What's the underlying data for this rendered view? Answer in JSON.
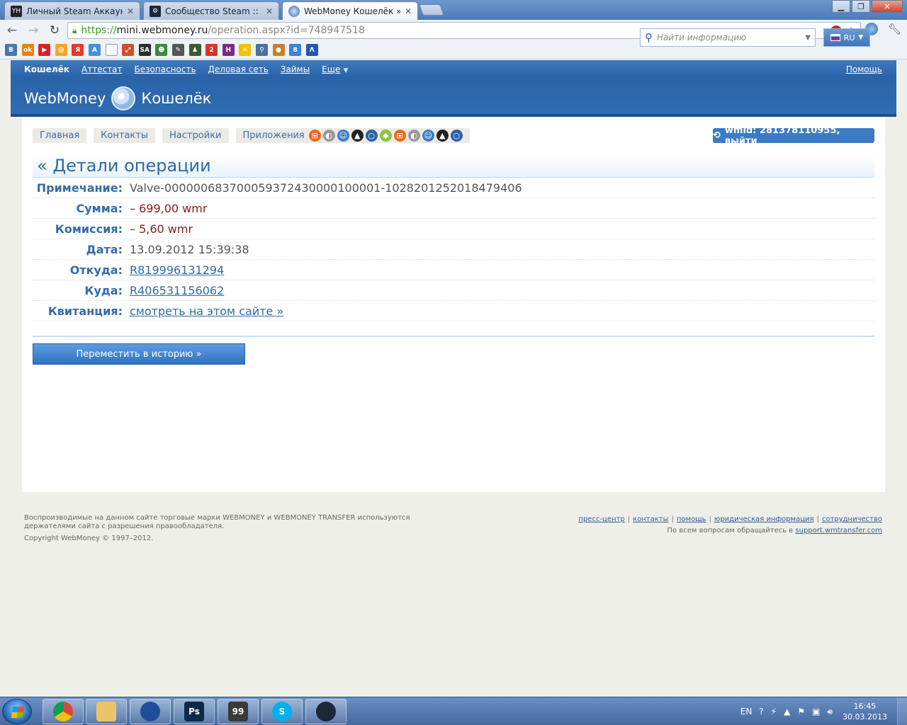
{
  "browser": {
    "tabs": [
      {
        "title": "Личный Steam Аккаунт",
        "favicon": "youhack-icon",
        "active": false
      },
      {
        "title": "Сообщество Steam :: Мо",
        "favicon": "steam-icon",
        "active": false
      },
      {
        "title": "WebMoney Кошелёк » Де",
        "favicon": "webmoney-globe-icon",
        "active": true
      }
    ],
    "url": {
      "scheme": "https://",
      "host": "mini.webmoney.ru",
      "path": "/operation.aspx?id=748947518"
    },
    "abp_label": "ABP",
    "bookmarks": [
      {
        "icon": "vk-icon",
        "label": "B",
        "color": "#4a76a8"
      },
      {
        "icon": "odnoklassniki-icon",
        "label": "ok",
        "color": "#ee8208"
      },
      {
        "icon": "youtube-icon",
        "label": "▶",
        "color": "#d32424"
      },
      {
        "icon": "moy-mir-icon",
        "label": "@",
        "color": "#f5a623"
      },
      {
        "icon": "yandex-icon",
        "label": "Я",
        "color": "#e53a2b"
      },
      {
        "icon": "a-icon",
        "label": "A",
        "color": "#4a90d9"
      },
      {
        "icon": "page-icon",
        "label": "",
        "color": "#ffffff"
      },
      {
        "icon": "link-icon",
        "label": "⤢",
        "color": "#d04e2f"
      },
      {
        "icon": "sa-icon",
        "label": "SA",
        "color": "#2b2b2b"
      },
      {
        "icon": "mask-icon",
        "label": "☻",
        "color": "#3a8a3a"
      },
      {
        "icon": "pen-icon",
        "label": "✎",
        "color": "#555555"
      },
      {
        "icon": "people-icon",
        "label": "♟",
        "color": "#3b5b2b"
      },
      {
        "icon": "2-icon",
        "label": "2",
        "color": "#d9342b"
      },
      {
        "icon": "h-icon",
        "label": "H",
        "color": "#7a2a8a"
      },
      {
        "icon": "x-icon",
        "label": "✕",
        "color": "#f2c200"
      },
      {
        "icon": "search-tool-icon",
        "label": "⚲",
        "color": "#4a6fa5"
      },
      {
        "icon": "cookie-icon",
        "label": "●",
        "color": "#c87f2a"
      },
      {
        "icon": "8-icon",
        "label": "8",
        "color": "#3f82d8"
      },
      {
        "icon": "arrow-a-icon",
        "label": "Λ",
        "color": "#2356b8"
      }
    ]
  },
  "wm": {
    "topnav": {
      "items": [
        "Кошелёк",
        "Аттестат",
        "Безопасность",
        "Деловая сеть",
        "Займы",
        "Еще"
      ],
      "help": "Помощь"
    },
    "brand": {
      "name": "WebMoney",
      "product": "Кошелёк"
    },
    "search": {
      "placeholder": "Найти информацию"
    },
    "lang": "RU",
    "subnav": {
      "home": "Главная",
      "contacts": "Контакты",
      "settings": "Настройки",
      "apps": "Приложения",
      "os_icons": [
        "windows-icon",
        "apple-icon",
        "mac-finder-icon",
        "linux-icon",
        "webmoney-circle-icon",
        "android-icon",
        "windows-icon",
        "apple-icon",
        "mac-finder-icon",
        "linux-icon",
        "webmoney-circle-icon"
      ]
    },
    "wmid_button": "wmid: 281378110955, выйти",
    "heading": "« Детали операции",
    "details": [
      {
        "label": "Примечание:",
        "value": "Valve-000000683700059372430000100001-1028201252018479406",
        "kind": "plain"
      },
      {
        "label": "Сумма:",
        "value": "– 699,00 wmr",
        "kind": "neg"
      },
      {
        "label": "Комиссия:",
        "value": "– 5,60 wmr",
        "kind": "neg"
      },
      {
        "label": "Дата:",
        "value": "13.09.2012 15:39:38",
        "kind": "plain"
      },
      {
        "label": "Откуда:",
        "value": "R819996131294",
        "kind": "link"
      },
      {
        "label": "Куда:",
        "value": "R406531156062",
        "kind": "link"
      },
      {
        "label": "Квитанция:",
        "value": "смотреть на этом сайте »",
        "kind": "link"
      }
    ],
    "move_button": "Переместить в историю »",
    "footer": {
      "legal": "Воспроизводимые на данном сайте торговые марки WEBMONEY и WEBMONEY TRANSFER используются держателями сайта с разрешения правообладателя.",
      "copyright": "Copyright WebMoney © 1997–2012.",
      "links": [
        "пресс-центр",
        "контакты",
        "помощь",
        "юридическая информация",
        "сотрудничество"
      ],
      "support_prefix": "По всем вопросам обращайтесь в",
      "support_link": "support.wmtransfer.com"
    }
  },
  "taskbar": {
    "apps": [
      {
        "name": "chrome-icon",
        "label": "",
        "color": "#dd4b39"
      },
      {
        "name": "explorer-icon",
        "label": "",
        "color": "#e9c46a"
      },
      {
        "name": "globe-app-icon",
        "label": "",
        "color": "#1f4f9c"
      },
      {
        "name": "photoshop-icon",
        "label": "Ps",
        "color": "#0b2a4a"
      },
      {
        "name": "monitor-app-icon",
        "label": "99",
        "color": "#3a3a3a"
      },
      {
        "name": "skype-icon",
        "label": "S",
        "color": "#00aff0"
      },
      {
        "name": "steam-icon",
        "label": "",
        "color": "#1b2838"
      }
    ],
    "lang": "EN",
    "time": "16:45",
    "date": "30.03.2013"
  }
}
